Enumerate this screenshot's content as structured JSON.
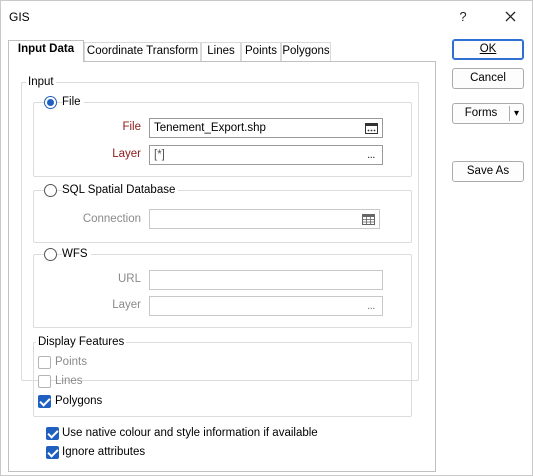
{
  "window": {
    "title": "GIS",
    "help_glyph": "?",
    "close_glyph": "✕"
  },
  "tabs": [
    {
      "label": "Input Data",
      "active": true
    },
    {
      "label": "Coordinate Transform",
      "active": false
    },
    {
      "label": "Lines",
      "active": false
    },
    {
      "label": "Points",
      "active": false
    },
    {
      "label": "Polygons",
      "active": false
    }
  ],
  "input_group": {
    "title": "Input",
    "file": {
      "option_label": "File",
      "selected": true,
      "file_label": "File",
      "file_value": "Tenement_Export.shp",
      "layer_label": "Layer",
      "layer_value": "[*]",
      "browse_glyph": "...",
      "file_browse_icon": "file-browse-icon"
    },
    "sql": {
      "option_label": "SQL Spatial Database",
      "selected": false,
      "connection_label": "Connection",
      "connection_value": "",
      "connection_icon": "table-icon"
    },
    "wfs": {
      "option_label": "WFS",
      "selected": false,
      "url_label": "URL",
      "url_value": "",
      "layer_label": "Layer",
      "layer_value": "",
      "browse_glyph": "..."
    }
  },
  "display_features": {
    "title": "Display Features",
    "items": [
      {
        "label": "Points",
        "checked": false,
        "enabled": false
      },
      {
        "label": "Lines",
        "checked": false,
        "enabled": false
      },
      {
        "label": "Polygons",
        "checked": true,
        "enabled": true
      }
    ]
  },
  "options": {
    "native_colour_label": "Use native colour and style information if available",
    "native_colour_checked": true,
    "ignore_attributes_label": "Ignore attributes",
    "ignore_attributes_checked": true
  },
  "buttons": {
    "ok_label": "OK",
    "cancel_label": "Cancel",
    "forms_label": "Forms",
    "forms_dropdown_glyph": "▾",
    "save_as_label": "Save As"
  }
}
